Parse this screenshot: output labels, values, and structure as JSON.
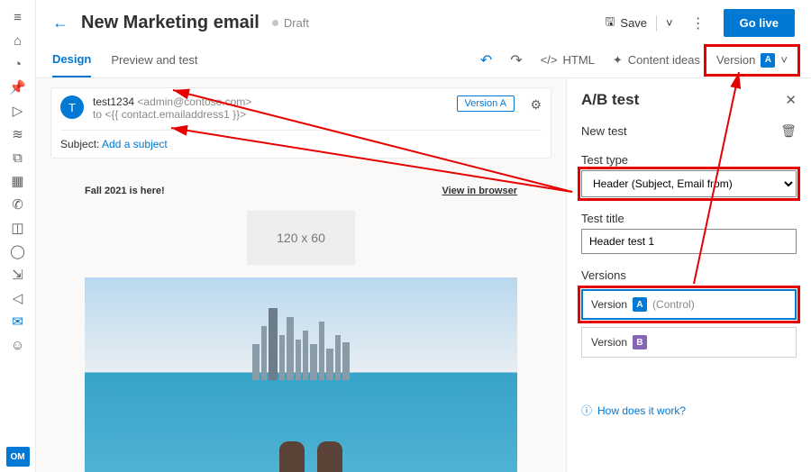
{
  "header": {
    "title": "New Marketing email",
    "status": "Draft",
    "save_label": "Save",
    "golive_label": "Go live"
  },
  "tabs": {
    "design": "Design",
    "preview": "Preview and test"
  },
  "toolbar": {
    "html": "HTML",
    "content_ideas": "Content ideas",
    "version_label": "Version"
  },
  "email_header": {
    "avatar_initial": "T",
    "display_name": "test1234",
    "from_address": "<admin@contoso.com>",
    "to_line": "to <{{ contact.emailaddress1 }}>",
    "version_badge": "Version A",
    "subject_label": "Subject:",
    "subject_placeholder": "Add a subject"
  },
  "email_body": {
    "headline": "Fall 2021 is here!",
    "view_in_browser": "View in browser",
    "logo_placeholder": "120 x 60"
  },
  "ab_panel": {
    "title": "A/B test",
    "new_test_label": "New test",
    "test_type_label": "Test type",
    "test_type_value": "Header (Subject, Email from)",
    "test_title_label": "Test title",
    "test_title_value": "Header test 1",
    "versions_label": "Versions",
    "version_a": "Version",
    "version_a_badge": "A",
    "version_a_note": "(Control)",
    "version_b": "Version",
    "version_b_badge": "B",
    "how_link": "How does it work?"
  },
  "leftrail_badge": "OM"
}
